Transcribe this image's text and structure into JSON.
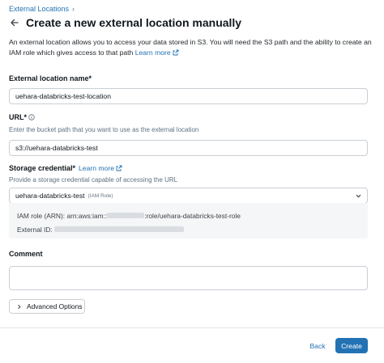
{
  "breadcrumb": {
    "label": "External Locations",
    "separator": "›"
  },
  "page": {
    "title": "Create a new external location manually"
  },
  "description": {
    "text": "An external location allows you to access your data stored in S3. You will need the S3 path and the ability to create an IAM role which gives access to that path",
    "link": "Learn more"
  },
  "name_field": {
    "label": "External location name*",
    "value": "uehara-databricks-test-location"
  },
  "url_field": {
    "label": "URL*",
    "hint": "Enter the bucket path that you want to use as the external location",
    "value": "s3://uehara-databricks-test"
  },
  "credential_field": {
    "label": "Storage credential*",
    "link": "Learn more",
    "hint": "Provide a storage credential capable of accessing the URL",
    "selected": "uehara-databricks-test",
    "selected_tag": "(IAM Role)"
  },
  "iam": {
    "role_label": "IAM role (ARN):",
    "role_prefix": "arn:aws:iam::",
    "role_suffix": ":role/uehara-databricks-test-role",
    "external_id_label": "External ID:"
  },
  "comment_field": {
    "label": "Comment",
    "value": ""
  },
  "advanced_options": {
    "label": "Advanced Options"
  },
  "footer": {
    "back_label": "Back",
    "create_label": "Create"
  },
  "colors": {
    "accent": "#2272b4",
    "border": "#c9cfd5",
    "panel": "#f5f6f7"
  },
  "icons": [
    "chevron-right-icon",
    "arrow-left-icon",
    "external-link-icon",
    "info-icon",
    "chevron-down-icon"
  ]
}
